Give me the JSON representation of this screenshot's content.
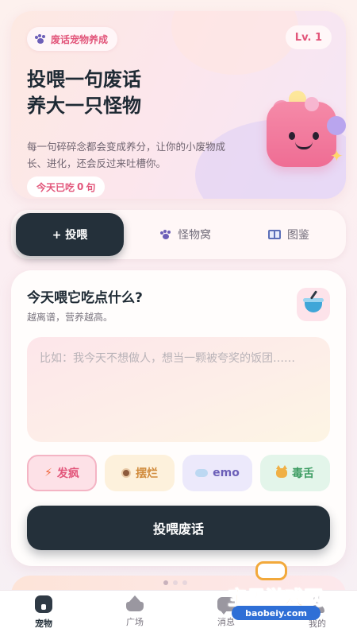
{
  "hero": {
    "tag": "废话宠物养成",
    "level": "Lv. 1",
    "title_line1": "投喂一句废话",
    "title_line2": "养大一只怪物",
    "description": "每一句碎碎念都会变成养分，让你的小废物成长、进化，还会反过来吐槽你。",
    "today_prefix": "今天已吃",
    "today_count": "0",
    "today_suffix": "句"
  },
  "tabs": [
    {
      "label": "+ 投喂",
      "icon": "plus-icon",
      "active": true
    },
    {
      "label": "怪物窝",
      "icon": "paw-icon",
      "active": false
    },
    {
      "label": "图鉴",
      "icon": "book-icon",
      "active": false
    }
  ],
  "feed": {
    "title": "今天喂它吃点什么?",
    "subtitle": "越离谱，营养越高。",
    "placeholder": "比如：我今天不想做人，想当一颗被夸奖的饭团……",
    "moods": [
      {
        "label": "发疯",
        "icon": "lightning-icon"
      },
      {
        "label": "摆烂",
        "icon": "bean-icon"
      },
      {
        "label": "emo",
        "icon": "cloud-icon"
      },
      {
        "label": "毒舌",
        "icon": "cat-icon"
      }
    ],
    "submit_label": "投喂废话"
  },
  "nav": [
    {
      "label": "宠物",
      "icon": "home-icon",
      "active": true
    },
    {
      "label": "广场",
      "icon": "crown-icon",
      "active": false
    },
    {
      "label": "消息",
      "icon": "message-icon",
      "active": false
    },
    {
      "label": "我的",
      "icon": "profile-icon",
      "active": false
    }
  ],
  "watermark": {
    "text": "宝贝游戏网",
    "url": "baobeiy.com"
  },
  "colors": {
    "accent_pink": "#e2557a",
    "dark": "#24303a",
    "monster_pink": "#ef6d94"
  }
}
